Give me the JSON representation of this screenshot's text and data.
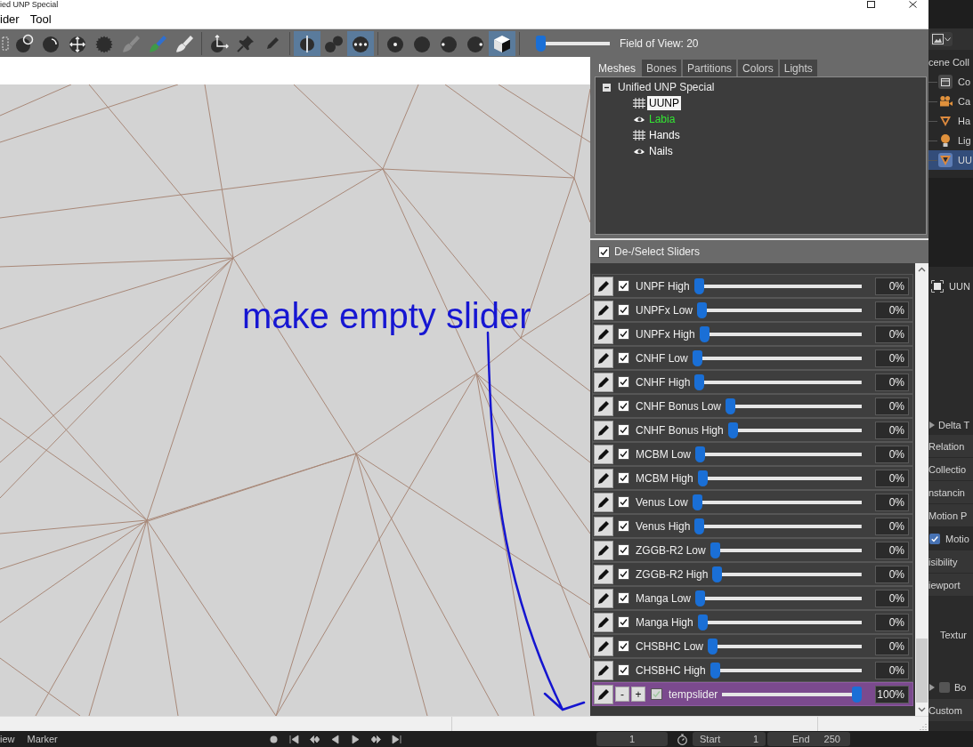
{
  "window": {
    "title": "ied UNP Special"
  },
  "menu": [
    {
      "label": "ider"
    },
    {
      "label": "Tool"
    }
  ],
  "toolbar": {
    "groups": [
      {
        "tools": [
          {
            "kind": "select",
            "selected": false
          },
          {
            "kind": "ring",
            "selected": false
          },
          {
            "kind": "crescent",
            "selected": false
          },
          {
            "kind": "move",
            "selected": false
          },
          {
            "kind": "jagged",
            "selected": false
          },
          {
            "kind": "brush-grey",
            "selected": false
          },
          {
            "kind": "brush-color",
            "selected": false
          },
          {
            "kind": "brush-white",
            "selected": false
          }
        ]
      },
      {
        "tools": [
          {
            "kind": "axes",
            "selected": false
          },
          {
            "kind": "pin",
            "selected": false
          },
          {
            "kind": "pencil",
            "selected": false
          }
        ]
      },
      {
        "tools": [
          {
            "kind": "mirror",
            "selected": true
          },
          {
            "kind": "pair",
            "selected": false
          },
          {
            "kind": "dots",
            "selected": true
          }
        ]
      },
      {
        "tools": [
          {
            "kind": "center-dot",
            "selected": false
          },
          {
            "kind": "plain",
            "selected": false
          },
          {
            "kind": "left-dot",
            "selected": false
          },
          {
            "kind": "right-dot",
            "selected": false
          },
          {
            "kind": "cube",
            "selected": true
          }
        ]
      }
    ],
    "fov_slider": {
      "level": 0
    },
    "fov_label": "Field of View: 20"
  },
  "viewport": {
    "annotation": "make empty slider"
  },
  "tabs": [
    {
      "label": "Meshes",
      "selected": true
    },
    {
      "label": "Bones",
      "selected": false
    },
    {
      "label": "Partitions",
      "selected": false
    },
    {
      "label": "Colors",
      "selected": false
    },
    {
      "label": "Lights",
      "selected": false
    }
  ],
  "mesh_tree": {
    "label": "Unified UNP Special",
    "expanded": true,
    "children": [
      {
        "label": "UUNP",
        "kind": "grid",
        "selected": true,
        "color": "#000000"
      },
      {
        "label": "Labia",
        "kind": "eye",
        "selected": false,
        "color": "#33e633"
      },
      {
        "label": "Hands",
        "kind": "grid",
        "selected": false,
        "color": "#ffffff"
      },
      {
        "label": "Nails",
        "kind": "eye",
        "selected": false,
        "color": "#ffffff"
      }
    ]
  },
  "select_sliders": {
    "label": "De-/Select Sliders",
    "checked": true
  },
  "sliders": [
    {
      "kind": "plain",
      "name": "UNPF High",
      "checked": true,
      "selected": false,
      "level": 0,
      "value": "0%"
    },
    {
      "kind": "plain",
      "name": "UNPFx Low",
      "checked": true,
      "selected": false,
      "level": 0,
      "value": "0%"
    },
    {
      "kind": "plain",
      "name": "UNPFx High",
      "checked": true,
      "selected": false,
      "level": 0,
      "value": "0%"
    },
    {
      "kind": "plain",
      "name": "CNHF Low",
      "checked": true,
      "selected": false,
      "level": 0,
      "value": "0%"
    },
    {
      "kind": "plain",
      "name": "CNHF High",
      "checked": true,
      "selected": false,
      "level": 0,
      "value": "0%"
    },
    {
      "kind": "plain",
      "name": "CNHF Bonus Low",
      "checked": true,
      "selected": false,
      "level": 0,
      "value": "0%"
    },
    {
      "kind": "plain",
      "name": "CNHF Bonus High",
      "checked": true,
      "selected": false,
      "level": 0,
      "value": "0%"
    },
    {
      "kind": "plain",
      "name": "MCBM Low",
      "checked": true,
      "selected": false,
      "level": 0,
      "value": "0%"
    },
    {
      "kind": "plain",
      "name": "MCBM High",
      "checked": true,
      "selected": false,
      "level": 0,
      "value": "0%"
    },
    {
      "kind": "plain",
      "name": "Venus Low",
      "checked": true,
      "selected": false,
      "level": 0,
      "value": "0%"
    },
    {
      "kind": "plain",
      "name": "Venus High",
      "checked": true,
      "selected": false,
      "level": 0,
      "value": "0%"
    },
    {
      "kind": "plain",
      "name": "ZGGB-R2 Low",
      "checked": true,
      "selected": false,
      "level": 0,
      "value": "0%"
    },
    {
      "kind": "plain",
      "name": "ZGGB-R2 High",
      "checked": true,
      "selected": false,
      "level": 0,
      "value": "0%"
    },
    {
      "kind": "plain",
      "name": "Manga Low",
      "checked": true,
      "selected": false,
      "level": 0,
      "value": "0%"
    },
    {
      "kind": "plain",
      "name": "Manga High",
      "checked": true,
      "selected": false,
      "level": 0,
      "value": "0%"
    },
    {
      "kind": "plain",
      "name": "CHSBHC Low",
      "checked": true,
      "selected": false,
      "level": 0,
      "value": "0%"
    },
    {
      "kind": "plain",
      "name": "CHSBHC High",
      "checked": true,
      "selected": false,
      "level": 0,
      "value": "0%"
    },
    {
      "kind": "edit",
      "buttons": [
        "-",
        "+"
      ],
      "name": "tempslider",
      "checked": true,
      "selected": true,
      "level": 1,
      "value": "100%"
    }
  ],
  "timeline": {
    "menus": [
      "iew",
      "Marker"
    ],
    "frame": "1",
    "start_label": "Start",
    "start": "1",
    "end_label": "End",
    "end": "250"
  },
  "blender": {
    "outliner": {
      "header": "cene Coll",
      "items": [
        {
          "label": "Co",
          "kind": "collection",
          "selected": false
        },
        {
          "label": "Ca",
          "kind": "camera",
          "selected": false
        },
        {
          "label": "Ha",
          "kind": "mesh",
          "selected": false
        },
        {
          "label": "Lig",
          "kind": "light",
          "selected": false
        },
        {
          "label": "UU",
          "kind": "mesh",
          "selected": true
        }
      ]
    },
    "properties": {
      "object": "UUN",
      "rows": [
        {
          "label": "Delta T",
          "kind": "subpanel"
        },
        {
          "label": "Relation",
          "kind": "panel"
        },
        {
          "label": "Collectio",
          "kind": "panel"
        },
        {
          "label": "nstancin",
          "kind": "panel"
        },
        {
          "label": "Motion P",
          "kind": "panel"
        },
        {
          "label": "Motio",
          "kind": "check",
          "checked": true
        },
        {
          "label": "isibility",
          "kind": "panel"
        },
        {
          "label": "iewport",
          "kind": "panel"
        },
        {
          "label": "Textur",
          "kind": "field"
        },
        {
          "label": "Bo",
          "kind": "subcheck",
          "checked": false
        },
        {
          "label": "Custom",
          "kind": "panel"
        }
      ]
    }
  }
}
